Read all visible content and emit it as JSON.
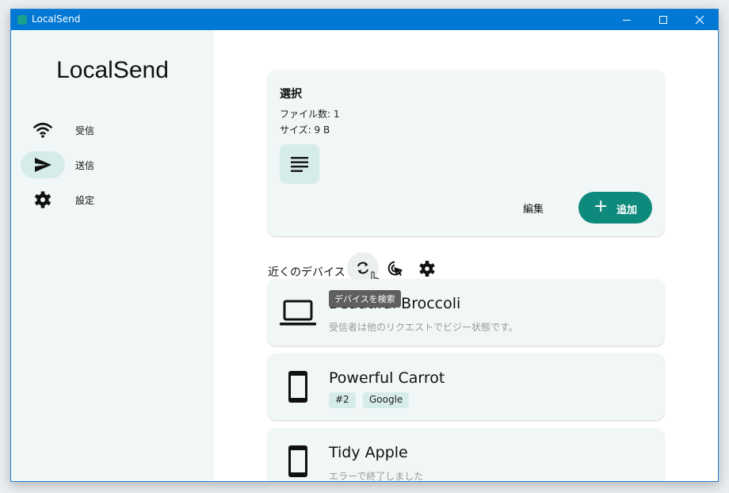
{
  "window": {
    "title": "LocalSend"
  },
  "sidebar": {
    "brand": "LocalSend",
    "items": [
      {
        "label": "受信",
        "icon": "wifi-icon"
      },
      {
        "label": "送信",
        "icon": "send-icon",
        "active": true
      },
      {
        "label": "設定",
        "icon": "gear-icon"
      }
    ]
  },
  "selection": {
    "title": "選択",
    "files_count": "ファイル数: 1",
    "size": "サイズ: 9 B",
    "edit_label": "編集",
    "add_label": "追加"
  },
  "nearby": {
    "title": "近くのデバイス",
    "tooltip": "デバイスを検索",
    "devices": [
      {
        "name": "Beautiful Broccoli",
        "status": "受信者は他のリクエストでビジー状態です。",
        "icon": "laptop-icon"
      },
      {
        "name": "Powerful Carrot",
        "tags": [
          "#2",
          "Google"
        ],
        "icon": "phone-icon"
      },
      {
        "name": "Tidy Apple",
        "status": "エラーで終了しました",
        "icon": "phone-icon"
      }
    ]
  },
  "colors": {
    "accent": "#0e8a7c",
    "titlebar": "#0078d4",
    "card": "#f1f6f7",
    "chip": "#d6ecea"
  }
}
